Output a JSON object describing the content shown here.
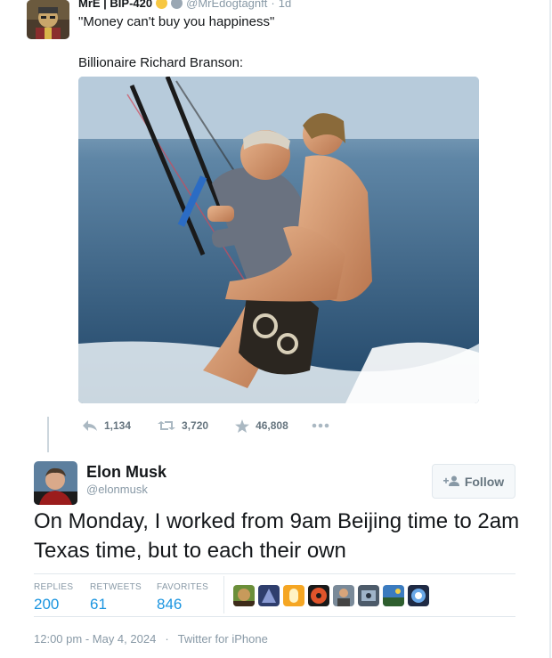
{
  "tweet1": {
    "display_name": "MrE | BIP-420",
    "handle": "@MrEdogtagnft",
    "separator": "·",
    "time": "1d",
    "text": "\"Money can't buy you happiness\"",
    "text_line2": "Billionaire Richard Branson:",
    "actions": {
      "replies": "1,134",
      "retweets": "3,720",
      "likes": "46,808"
    }
  },
  "tweet2": {
    "display_name": "Elon Musk",
    "handle": "@elonmusk",
    "follow_label": "Follow",
    "text": "On Monday, I worked from 9am Beijing time to 2am Texas time, but to each their own",
    "stats": {
      "replies_label": "REPLIES",
      "replies_value": "200",
      "retweets_label": "RETWEETS",
      "retweets_value": "61",
      "favorites_label": "FAVORITES",
      "favorites_value": "846"
    },
    "timestamp": "12:00 pm - May 4, 2024",
    "dot": "·",
    "source": "Twitter for iPhone"
  },
  "colors": {
    "accent_blue": "#1b95e0",
    "muted_text": "#8899a6",
    "action_gray": "#66757f",
    "divider": "#e1e8ed"
  }
}
